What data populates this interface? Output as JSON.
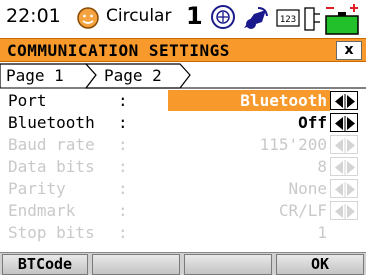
{
  "status": {
    "time": "22:01",
    "mode": "Circular",
    "face_number": "1",
    "keyboard_label": "123",
    "icons": [
      "smiley-icon",
      "target-icon",
      "satellite-icon",
      "keyboard-icon",
      "plug-icon",
      "battery-icon"
    ]
  },
  "title": "COMMUNICATION SETTINGS",
  "close_label": "x",
  "tabs": [
    {
      "label": "Page 1",
      "active": true
    },
    {
      "label": "Page 2",
      "active": false
    }
  ],
  "rows": [
    {
      "label": "Port",
      "colon": ":",
      "value": "Bluetooth",
      "state": "selected"
    },
    {
      "label": "Bluetooth",
      "colon": ":",
      "value": "Off",
      "state": "enabled"
    },
    {
      "label": "Baud rate",
      "colon": ":",
      "value": "115'200",
      "state": "disabled"
    },
    {
      "label": "Data bits",
      "colon": ":",
      "value": "8",
      "state": "disabled"
    },
    {
      "label": "Parity",
      "colon": ":",
      "value": "None",
      "state": "disabled"
    },
    {
      "label": "Endmark",
      "colon": ":",
      "value": "CR/LF",
      "state": "disabled"
    },
    {
      "label": "Stop bits",
      "colon": ":",
      "value": "1",
      "state": "disabled"
    }
  ],
  "softkeys": [
    "BTCode",
    "",
    "",
    "OK"
  ],
  "colors": {
    "accent": "#f79a2b",
    "disabled_text": "#c9c9c9",
    "battery_green": "#22c02a"
  }
}
